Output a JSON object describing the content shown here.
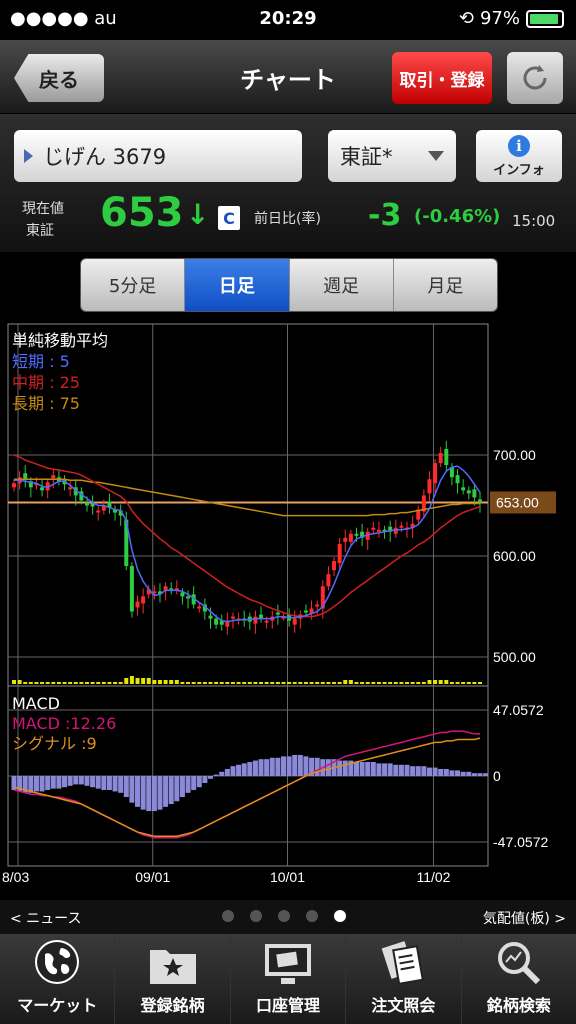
{
  "status": {
    "carrier": "●●●●● au",
    "time": "20:29",
    "battery": "97%"
  },
  "nav": {
    "back": "戻る",
    "title": "チャート",
    "trade": "取引・登録"
  },
  "stock": {
    "name": "じげん 3679",
    "exchange": "東証*",
    "info": "インフォ"
  },
  "quote": {
    "label_price": "現在値",
    "label_market": "東証",
    "price": "653",
    "arrow": "↓",
    "flag": "C",
    "label_change": "前日比(率)",
    "change": "-3",
    "change_pct": "(-0.46%)",
    "time": "15:00"
  },
  "periods": [
    "5分足",
    "日足",
    "週足",
    "月足"
  ],
  "active_period": 1,
  "legend": {
    "title": "単純移動平均",
    "short": "短期 : 5",
    "mid": "中期 : 25",
    "long": "長期 : 75"
  },
  "macd": {
    "title": "MACD",
    "macd": "MACD :12.26",
    "signal": "シグナル :9"
  },
  "bottom": {
    "news": "< ニュース",
    "board": "気配値(板) >",
    "dots": 5,
    "active_dot": 4
  },
  "tabs": [
    {
      "label": "マーケット",
      "icon": "globe-icon"
    },
    {
      "label": "登録銘柄",
      "icon": "star-folder-icon"
    },
    {
      "label": "口座管理",
      "icon": "monitor-icon"
    },
    {
      "label": "注文照会",
      "icon": "documents-icon"
    },
    {
      "label": "銘柄検索",
      "icon": "magnifier-icon"
    }
  ],
  "colors": {
    "up": "#ff2a2a",
    "down": "#2ecc40",
    "short": "#4f6cff",
    "mid": "#d02020",
    "long": "#c58a10",
    "macd": "#d4147a",
    "signal": "#e0901a",
    "hist": "#8a8ad8"
  },
  "chart_data": {
    "type": "candlestick",
    "price_axis": {
      "ticks": [
        700,
        600,
        500
      ],
      "tick_labels": [
        "700.00",
        "600.00",
        "500.00"
      ],
      "current": 653,
      "current_label": "653.00"
    },
    "macd_axis": {
      "tick_labels": [
        "47.0572",
        "0",
        "-47.0572"
      ],
      "range": [
        -47.0572,
        47.0572
      ]
    },
    "x_labels": [
      "8/03",
      "09/01",
      "10/01",
      "11/02"
    ],
    "close": [
      672,
      678,
      676,
      668,
      672,
      665,
      673,
      680,
      674,
      671,
      668,
      660,
      655,
      650,
      649,
      645,
      650,
      648,
      643,
      640,
      590,
      545,
      555,
      560,
      567,
      565,
      562,
      570,
      566,
      568,
      560,
      558,
      552,
      550,
      545,
      538,
      532,
      532,
      536,
      540,
      538,
      536,
      535,
      540,
      538,
      536,
      540,
      542,
      540,
      536,
      538,
      542,
      545,
      548,
      552,
      570,
      582,
      595,
      612,
      618,
      622,
      620,
      618,
      624,
      628,
      626,
      625,
      624,
      628,
      630,
      628,
      632,
      646,
      660,
      676,
      692,
      702,
      690,
      678,
      672,
      665,
      662,
      658,
      653
    ],
    "short_ma": [
      675,
      675,
      674,
      673,
      672,
      669,
      668,
      671,
      674,
      674,
      670,
      665,
      661,
      657,
      653,
      650,
      650,
      648,
      646,
      645,
      635,
      606,
      587,
      575,
      567,
      561,
      562,
      566,
      566,
      566,
      565,
      562,
      558,
      554,
      550,
      545,
      540,
      536,
      535,
      536,
      537,
      537,
      537,
      538,
      538,
      538,
      538,
      540,
      540,
      539,
      539,
      540,
      541,
      543,
      545,
      550,
      560,
      572,
      586,
      599,
      610,
      617,
      619,
      621,
      622,
      623,
      624,
      625,
      626,
      626,
      627,
      628,
      631,
      638,
      647,
      661,
      675,
      684,
      688,
      689,
      685,
      679,
      671,
      663
    ],
    "mid_ma": [
      700,
      698,
      695,
      693,
      691,
      689,
      687,
      686,
      685,
      684,
      683,
      682,
      680,
      677,
      674,
      671,
      668,
      665,
      662,
      659,
      654,
      645,
      638,
      632,
      627,
      622,
      617,
      613,
      608,
      605,
      601,
      597,
      593,
      589,
      585,
      581,
      577,
      573,
      569,
      566,
      563,
      560,
      557,
      555,
      553,
      550,
      548,
      546,
      544,
      542,
      541,
      540,
      540,
      540,
      541,
      543,
      546,
      550,
      554,
      559,
      564,
      568,
      572,
      576,
      580,
      584,
      588,
      592,
      596,
      600,
      603,
      607,
      611,
      614,
      618,
      623,
      628,
      632,
      636,
      640,
      643,
      645,
      647,
      649
    ],
    "long_ma": [
      676,
      676,
      676,
      676,
      676,
      676,
      676,
      676,
      676,
      676,
      675,
      675,
      675,
      674,
      673,
      673,
      672,
      671,
      670,
      669,
      668,
      667,
      666,
      665,
      664,
      663,
      662,
      661,
      660,
      659,
      658,
      657,
      656,
      655,
      654,
      653,
      652,
      651,
      650,
      649,
      648,
      647,
      646,
      645,
      644,
      643,
      642,
      641,
      640,
      640,
      640,
      640,
      640,
      640,
      640,
      640,
      640,
      640,
      640,
      640,
      640,
      640,
      640,
      640,
      641,
      641,
      641,
      642,
      642,
      643,
      643,
      644,
      645,
      646,
      647,
      648,
      649,
      650,
      651,
      651,
      652,
      652,
      652,
      652
    ],
    "volume": [
      2,
      2,
      1,
      1,
      1,
      1,
      1,
      1,
      1,
      1,
      1,
      1,
      1,
      1,
      1,
      1,
      1,
      1,
      1,
      1,
      3,
      4,
      3,
      3,
      3,
      2,
      2,
      2,
      2,
      2,
      1,
      1,
      1,
      1,
      1,
      1,
      1,
      1,
      1,
      1,
      1,
      1,
      1,
      1,
      1,
      1,
      1,
      1,
      1,
      1,
      1,
      1,
      1,
      1,
      1,
      1,
      1,
      1,
      1,
      2,
      2,
      1,
      1,
      1,
      1,
      1,
      1,
      1,
      1,
      1,
      1,
      1,
      1,
      1,
      2,
      2,
      2,
      2,
      1,
      1,
      1,
      1,
      1,
      1
    ],
    "macd_hist": [
      -10,
      -11,
      -12,
      -12,
      -11,
      -11,
      -10,
      -9,
      -9,
      -8,
      -7,
      -6,
      -6,
      -7,
      -8,
      -9,
      -10,
      -10,
      -11,
      -12,
      -15,
      -19,
      -22,
      -24,
      -25,
      -25,
      -24,
      -22,
      -20,
      -18,
      -15,
      -12,
      -10,
      -8,
      -5,
      -2,
      1,
      3,
      5,
      7,
      8,
      9,
      10,
      11,
      12,
      12,
      13,
      13,
      14,
      14,
      15,
      15,
      14,
      13,
      13,
      12,
      12,
      12,
      11,
      11,
      11,
      10,
      10,
      10,
      10,
      9,
      9,
      9,
      8,
      8,
      8,
      7,
      7,
      7,
      6,
      6,
      5,
      5,
      4,
      4,
      3,
      3,
      2,
      2,
      2
    ],
    "macd_line": [
      -10,
      -11,
      -12,
      -13,
      -13,
      -14,
      -14,
      -15,
      -15,
      -16,
      -17,
      -18,
      -20,
      -22,
      -24,
      -26,
      -28,
      -30,
      -32,
      -34,
      -36,
      -38,
      -40,
      -42,
      -43,
      -44,
      -44,
      -44,
      -44,
      -44,
      -43,
      -42,
      -40,
      -38,
      -36,
      -34,
      -32,
      -30,
      -28,
      -26,
      -24,
      -22,
      -20,
      -18,
      -16,
      -14,
      -12,
      -10,
      -8,
      -6,
      -4,
      -2,
      0,
      2,
      4,
      6,
      8,
      10,
      12,
      14,
      15,
      16,
      17,
      18,
      19,
      20,
      21,
      22,
      23,
      24,
      25,
      26,
      27,
      28,
      29,
      30,
      31,
      31,
      32,
      32,
      32,
      31,
      30,
      30
    ],
    "signal_line": [
      -8,
      -9,
      -10,
      -11,
      -12,
      -13,
      -14,
      -15,
      -16,
      -17,
      -18,
      -19,
      -20,
      -22,
      -24,
      -26,
      -28,
      -30,
      -32,
      -34,
      -36,
      -38,
      -40,
      -41,
      -42,
      -43,
      -43,
      -43,
      -43,
      -43,
      -42,
      -41,
      -40,
      -38,
      -36,
      -34,
      -32,
      -30,
      -28,
      -26,
      -24,
      -22,
      -20,
      -18,
      -16,
      -14,
      -12,
      -10,
      -8,
      -6,
      -4,
      -2,
      0,
      2,
      3,
      4,
      5,
      6,
      7,
      8,
      9,
      10,
      11,
      12,
      13,
      14,
      15,
      16,
      17,
      18,
      19,
      20,
      21,
      22,
      23,
      24,
      24,
      25,
      25,
      26,
      26,
      26,
      26,
      27
    ]
  }
}
